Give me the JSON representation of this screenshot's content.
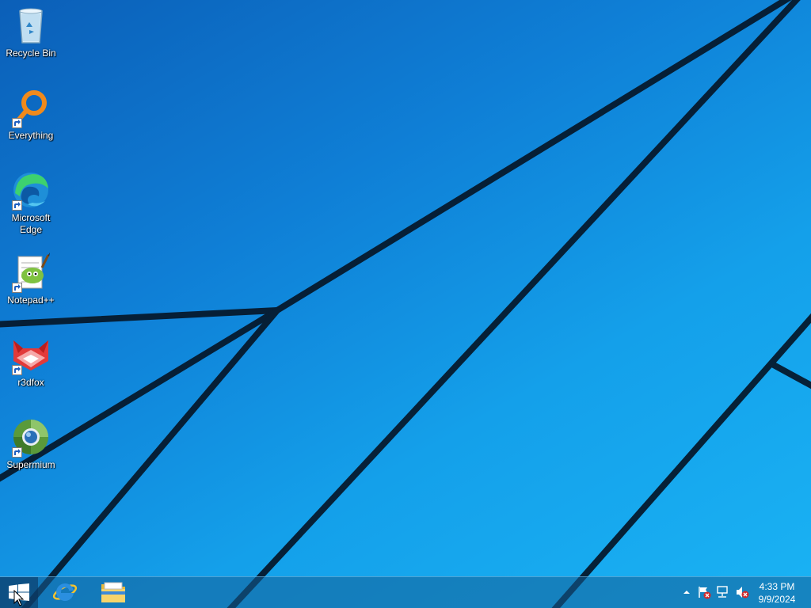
{
  "desktop": {
    "icons": [
      {
        "label": "Recycle Bin",
        "icon": "recycle-bin-icon",
        "shortcut": false
      },
      {
        "label": "Everything",
        "icon": "everything-icon",
        "shortcut": true
      },
      {
        "label": "Microsoft Edge",
        "icon": "edge-icon",
        "shortcut": true
      },
      {
        "label": "Notepad++",
        "icon": "notepadpp-icon",
        "shortcut": true
      },
      {
        "label": "r3dfox",
        "icon": "r3dfox-icon",
        "shortcut": true
      },
      {
        "label": "Supermium",
        "icon": "supermium-icon",
        "shortcut": true
      }
    ]
  },
  "taskbar": {
    "start": {
      "icon": "windows-logo-icon"
    },
    "pinned": [
      {
        "name": "Internet Explorer",
        "icon": "internet-explorer-icon"
      },
      {
        "name": "File Explorer",
        "icon": "file-explorer-icon"
      }
    ],
    "tray": {
      "icons": [
        "show-hidden-icons-chevron",
        "action-center-flag-icon",
        "network-icon",
        "volume-muted-icon"
      ],
      "time": "4:33 PM",
      "date": "9/9/2024"
    }
  },
  "colors": {
    "wallpaper_dark": "#0b5fb8",
    "wallpaper_light": "#1ab3f4",
    "wallpaper_lines": "#061a2e"
  }
}
